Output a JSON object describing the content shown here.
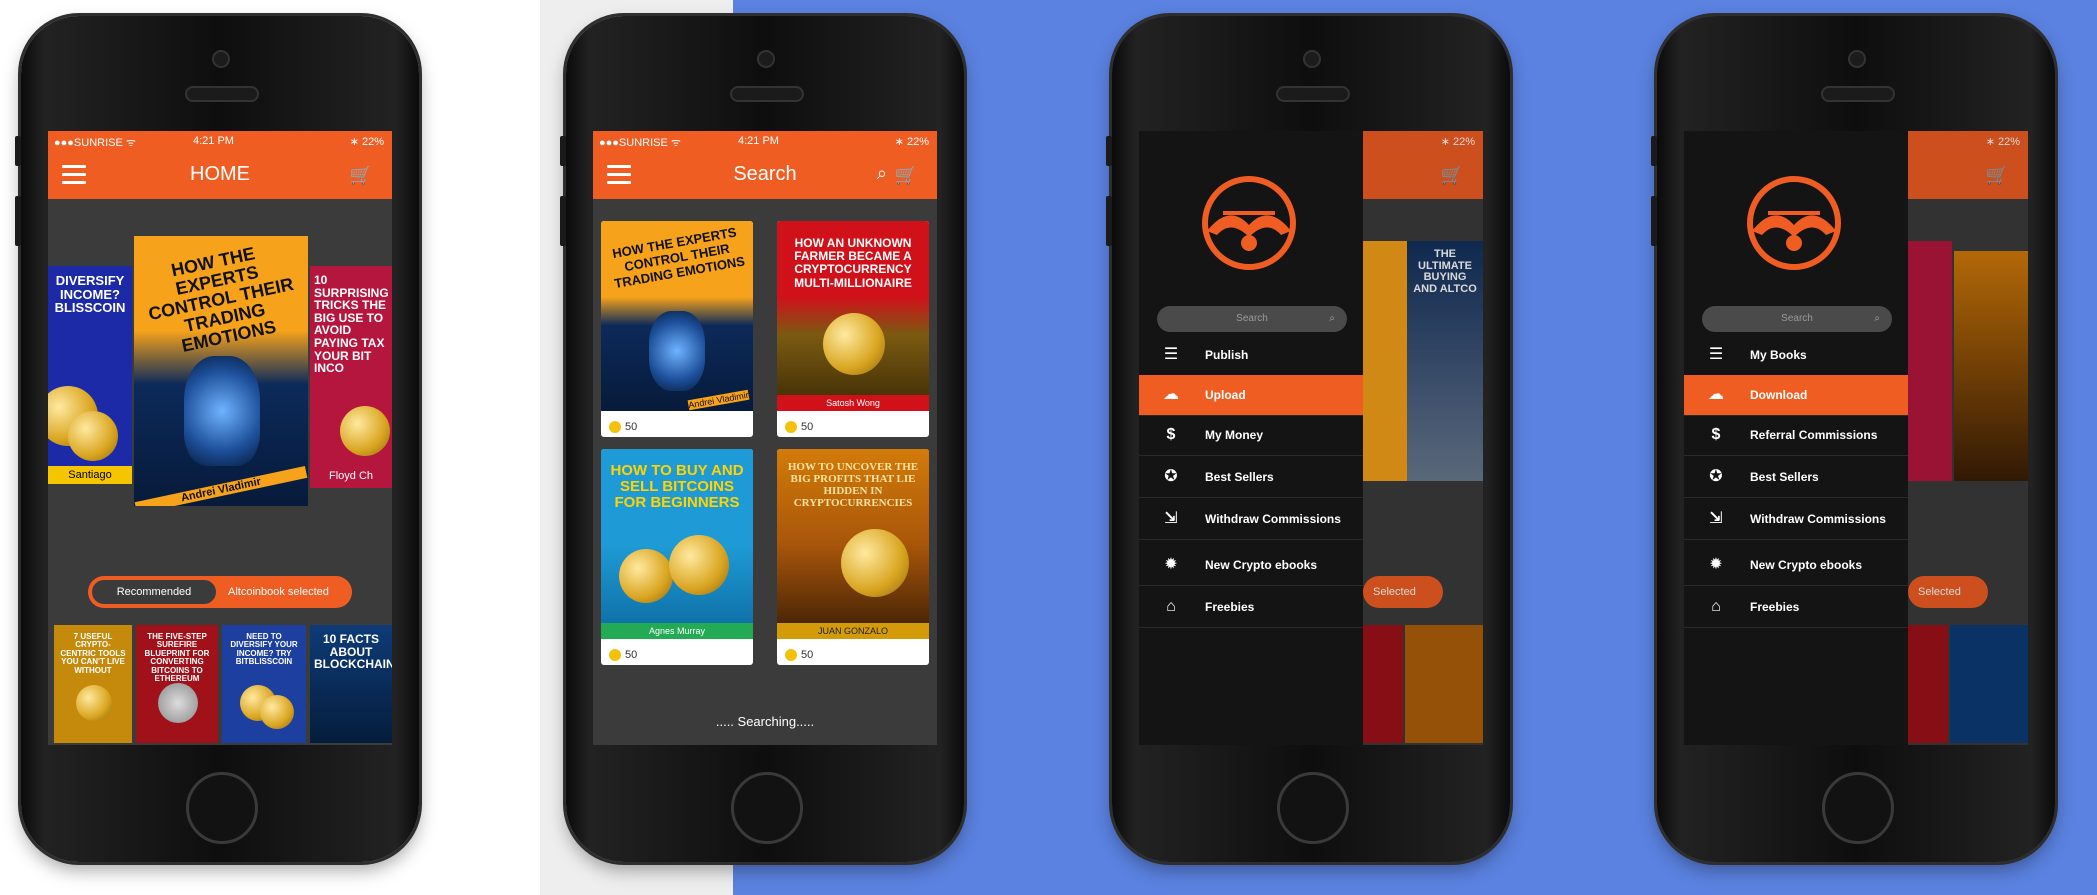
{
  "colors": {
    "accent": "#f05d23",
    "screen_bg": "#3b3b3b",
    "backdrop": "#5b82e1"
  },
  "status": {
    "carrier": "●●●SUNRISE ᯤ",
    "time": "4:21 PM",
    "battery": "∗ 22%"
  },
  "phone1": {
    "title": "HOME",
    "carousel": [
      {
        "title": "DIVERSIFY INCOME? BLISSCOIN",
        "author": "Santiago"
      },
      {
        "title": "HOW THE EXPERTS CONTROL THEIR TRADING EMOTIONS",
        "author": "Andrei Vladimir"
      },
      {
        "title": "10 SURPRISING TRICKS THE BIG USE TO AVOID PAYING TAX YOUR BIT INCO",
        "author": "Floyd Ch"
      }
    ],
    "toggle": {
      "left": "Recommended",
      "right": "Altcoinbook selected"
    },
    "shelf": [
      {
        "title": "7 USEFUL CRYPTO-CENTRIC TOOLS YOU CAN'T LIVE WITHOUT",
        "author": ""
      },
      {
        "title": "THE FIVE-STEP SUREFIRE BLUEPRINT FOR CONVERTING BITCOINS TO ETHEREUM",
        "author": ""
      },
      {
        "title": "NEED TO DIVERSIFY YOUR INCOME? TRY BITBLISSCOIN",
        "author": ""
      },
      {
        "title": "10 FACTS ABOUT BLOCKCHAIN",
        "author": ""
      }
    ]
  },
  "phone2": {
    "title": "Search",
    "cards": [
      {
        "title": "HOW THE EXPERTS CONTROL THEIR TRADING EMOTIONS",
        "author": "Andrei Vladimir",
        "price": "50"
      },
      {
        "title": "HOW AN UNKNOWN FARMER BECAME A CRYPTOCURRENCY MULTI-MILLIONAIRE",
        "author": "Satosh Wong",
        "price": "50"
      },
      {
        "title": "HOW TO BUY AND SELL BITCOINS FOR BEGINNERS",
        "author": "Agnes Murray",
        "price": "50"
      },
      {
        "title": "HOW TO UNCOVER THE BIG PROFITS THAT LIE HIDDEN IN CRYPTOCURRENCIES",
        "author": "JUAN GONZALO",
        "price": "50"
      }
    ],
    "searching": "..... Searching....."
  },
  "phone3": {
    "search_placeholder": "Search",
    "menu": [
      {
        "label": "Publish",
        "icon": "books-icon",
        "glyph": "☰"
      },
      {
        "label": "Upload",
        "icon": "cloud-upload-icon",
        "glyph": "☁",
        "active": true
      },
      {
        "label": "My Money",
        "icon": "money-bag-icon",
        "glyph": "$"
      },
      {
        "label": "Best Sellers",
        "icon": "ribbon-icon",
        "glyph": "✪"
      },
      {
        "label": "Withdraw Commissions",
        "icon": "withdraw-icon",
        "glyph": "⇲"
      },
      {
        "label": "New Crypto ebooks",
        "icon": "new-badge-icon",
        "glyph": "✹"
      },
      {
        "label": "Freebies",
        "icon": "tag-icon",
        "glyph": "⌂"
      }
    ],
    "peek_toggle": "Selected",
    "peek_book": "THE ULTIMATE BUYING AND ALTCO"
  },
  "phone4": {
    "search_placeholder": "Search",
    "menu": [
      {
        "label": "My Books",
        "icon": "books-icon",
        "glyph": "☰"
      },
      {
        "label": "Download",
        "icon": "cloud-download-icon",
        "glyph": "☁",
        "active": true
      },
      {
        "label": "Referral Commissions",
        "icon": "money-bag-icon",
        "glyph": "$"
      },
      {
        "label": "Best Sellers",
        "icon": "ribbon-icon",
        "glyph": "✪"
      },
      {
        "label": "Withdraw Commissions",
        "icon": "withdraw-icon",
        "glyph": "⇲"
      },
      {
        "label": "New Crypto ebooks",
        "icon": "new-badge-icon",
        "glyph": "✹"
      },
      {
        "label": "Freebies",
        "icon": "tag-icon",
        "glyph": "⌂"
      }
    ],
    "peek_toggle": "Selected"
  }
}
